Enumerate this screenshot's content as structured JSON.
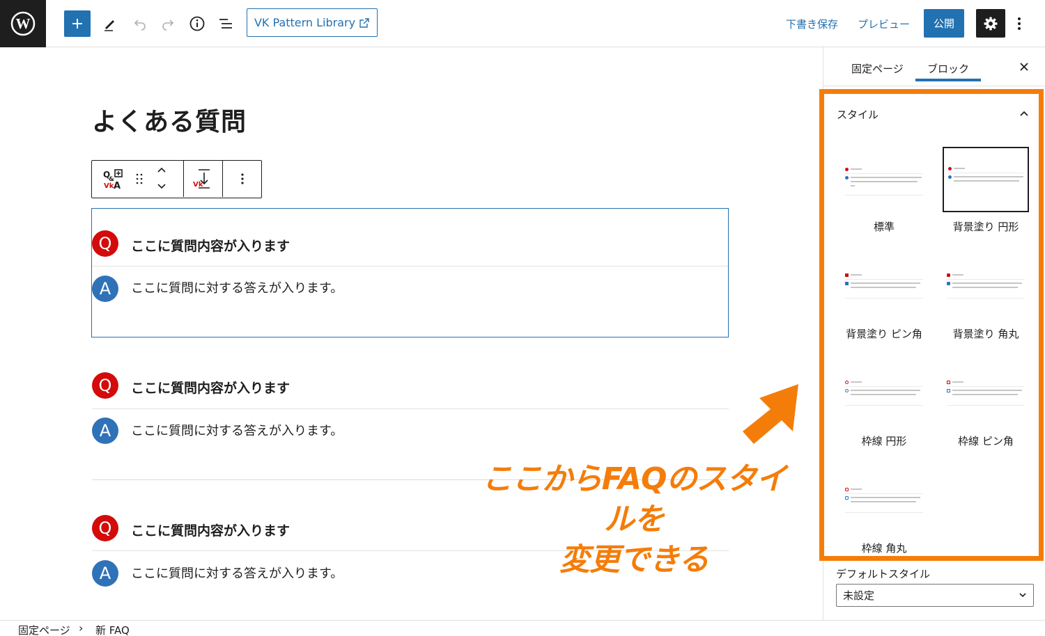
{
  "toolbar": {
    "pattern_library_label": "VK Pattern Library",
    "save_draft_label": "下書き保存",
    "preview_label": "プレビュー",
    "publish_label": "公開"
  },
  "editor": {
    "page_title": "よくある質問",
    "faq_items": [
      {
        "q_badge": "Q",
        "question": "ここに質問内容が入ります",
        "a_badge": "A",
        "answer": "ここに質問に対する答えが入ります。"
      },
      {
        "q_badge": "Q",
        "question": "ここに質問内容が入ります",
        "a_badge": "A",
        "answer": "ここに質問に対する答えが入ります。"
      },
      {
        "q_badge": "Q",
        "question": "ここに質問内容が入ります",
        "a_badge": "A",
        "answer": "ここに質問に対する答えが入ります。"
      }
    ]
  },
  "sidebar": {
    "tabs": [
      {
        "label": "固定ページ",
        "active": false
      },
      {
        "label": "ブロック",
        "active": true
      }
    ],
    "styles_panel": {
      "title": "スタイル",
      "options": [
        {
          "label": "標準",
          "selected": false
        },
        {
          "label": "背景塗り 円形",
          "selected": true
        },
        {
          "label": "背景塗り ピン角",
          "selected": false
        },
        {
          "label": "背景塗り 角丸",
          "selected": false
        },
        {
          "label": "枠線 円形",
          "selected": false
        },
        {
          "label": "枠線 ピン角",
          "selected": false
        },
        {
          "label": "枠線 角丸",
          "selected": false
        }
      ],
      "default_style_label": "デフォルトスタイル",
      "default_style_value": "未設定"
    }
  },
  "annotation": {
    "line1": "ここからFAQのスタイルを",
    "line2": "変更できる",
    "color": "#f47d0a"
  },
  "breadcrumb": {
    "items": [
      "固定ページ",
      "新 FAQ"
    ],
    "separator": "›"
  },
  "colors": {
    "accent": "#2271b1",
    "question_badge": "#d40b0b",
    "answer_badge": "#2f72b8",
    "highlight": "#f47d0a"
  }
}
